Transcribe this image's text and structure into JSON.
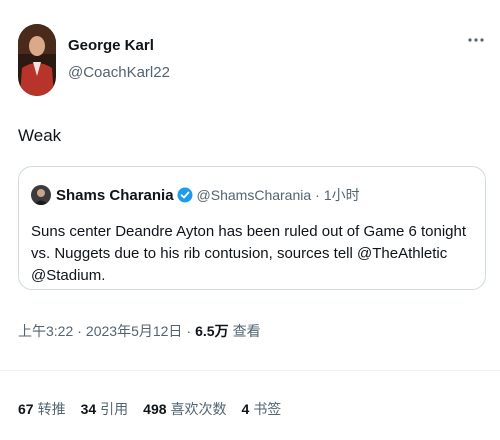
{
  "author": {
    "name": "George Karl",
    "handle": "@CoachKarl22"
  },
  "more_icon": "more-horizontal-icon",
  "tweet": {
    "text": "Weak"
  },
  "quoted": {
    "name": "Shams Charania",
    "verified_icon": "verified-badge-icon",
    "verified_color": "#1d9bf0",
    "handle": "@ShamsCharania",
    "dot": "·",
    "time": "1小时",
    "text": "Suns center Deandre Ayton has been ruled out of Game 6 tonight vs. Nuggets due to his rib contusion, sources tell @TheAthletic @Stadium."
  },
  "meta": {
    "time": "上午3:22",
    "sep": "·",
    "date": "2023年5月12日",
    "views_count": "6.5万",
    "views_label": "查看"
  },
  "stats": [
    {
      "count": "67",
      "label": "转推"
    },
    {
      "count": "34",
      "label": "引用"
    },
    {
      "count": "498",
      "label": "喜欢次数"
    },
    {
      "count": "4",
      "label": "书签"
    }
  ],
  "colors": {
    "text": "#0f1419",
    "secondary": "#536471",
    "border": "#cfd9de"
  }
}
